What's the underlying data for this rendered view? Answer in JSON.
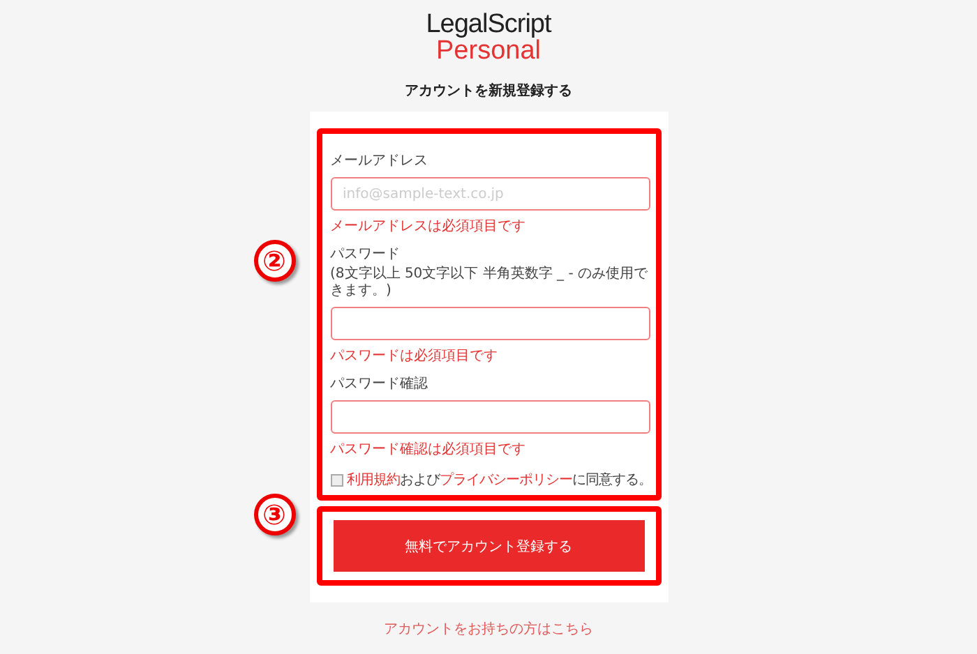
{
  "logo": {
    "top": "LegalScript",
    "bottom": "Personal"
  },
  "title": "アカウントを新規登録する",
  "callouts": [
    "②",
    "③"
  ],
  "fields": [
    {
      "label": "メールアドレス",
      "placeholder": "info@sample-text.co.jp",
      "error": "メールアドレスは必須項目です"
    },
    {
      "label": "パスワード",
      "hint": "(8文字以上 50文字以下 半角英数字 _ - のみ使用できます。)",
      "error": "パスワードは必須項目です"
    },
    {
      "label": "パスワード確認",
      "error": "パスワード確認は必須項目です"
    }
  ],
  "agreement": {
    "checked": false,
    "parts": [
      {
        "kind": "link",
        "text": "利用規約"
      },
      {
        "kind": "plain",
        "text": "および"
      },
      {
        "kind": "link",
        "text": "プライバシーポリシー"
      },
      {
        "kind": "plain",
        "text": "に同意する。"
      }
    ]
  },
  "submit": "無料でアカウント登録する",
  "login_link": "アカウントをお持ちの方はこちら"
}
